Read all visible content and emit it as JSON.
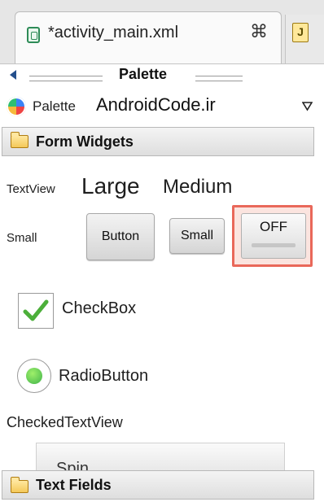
{
  "tabs": {
    "active_title": "*activity_main.xml",
    "close_glyph": "⌘",
    "next_tab_glyph": "J"
  },
  "palette_header": {
    "title": "Palette"
  },
  "palette_selector": {
    "label": "Palette",
    "value": "AndroidCode.ir"
  },
  "categories": {
    "form_widgets": "Form Widgets",
    "text_fields": "Text Fields"
  },
  "widgets": {
    "textview_small": "TextView",
    "large": "Large",
    "medium": "Medium",
    "small_text": "Small",
    "button": "Button",
    "small_button": "Small",
    "toggle_label": "OFF",
    "checkbox": "CheckBox",
    "radio": "RadioButton",
    "checked_textview": "CheckedTextView",
    "spinner_partial": "Spin..."
  },
  "colors": {
    "highlight_border": "#e9685a",
    "check_green": "#4caf3a"
  }
}
